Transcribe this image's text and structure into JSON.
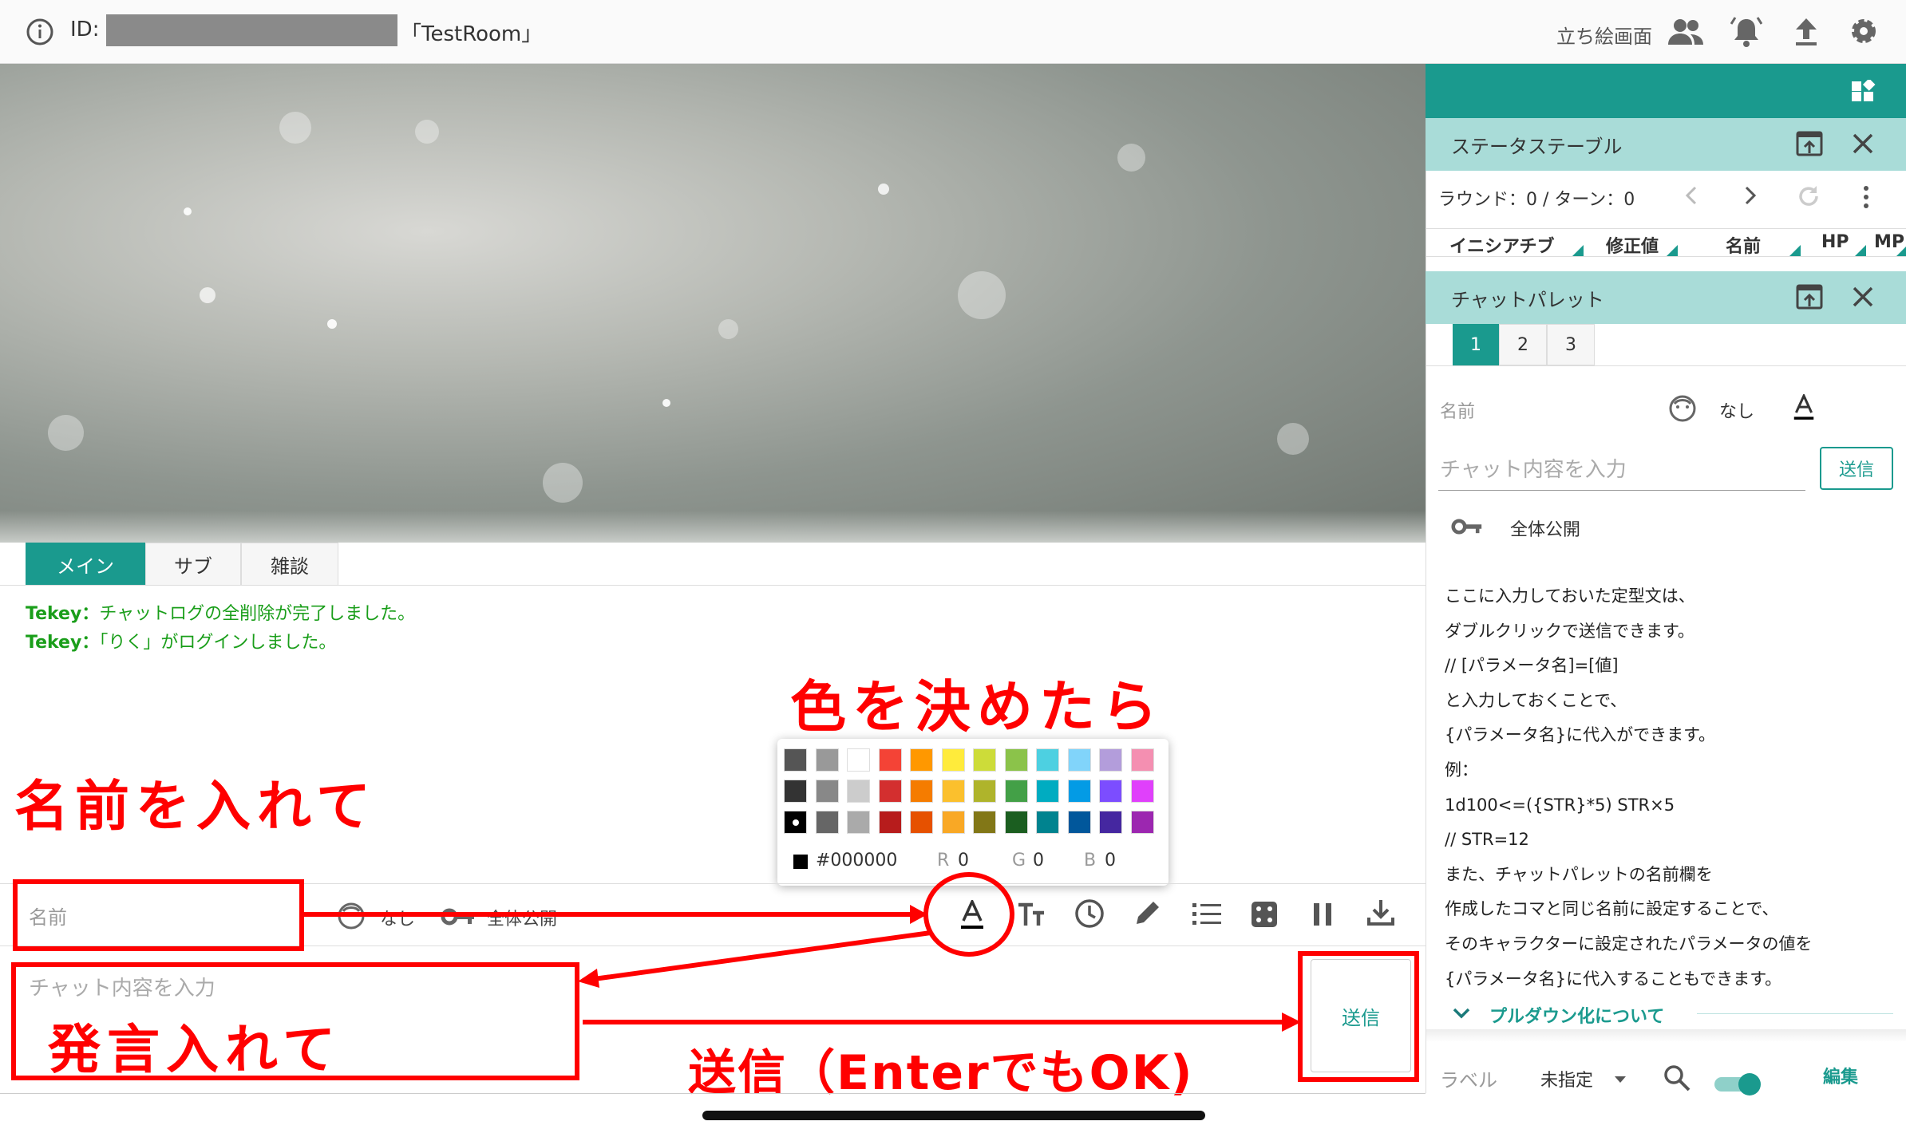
{
  "topbar": {
    "id_label": "ID:",
    "room_name": "「TestRoom」",
    "standing_view": "立ち絵画面"
  },
  "tabs": [
    "メイン",
    "サブ",
    "雑談"
  ],
  "chatlog": [
    {
      "speaker": "Tekey：",
      "text": "チャットログの全削除が完了しました。"
    },
    {
      "speaker": "Tekey：",
      "text": "「りく」がログインしました。"
    }
  ],
  "input": {
    "name_placeholder": "名前",
    "avatar_label": "なし",
    "visibility": "全体公開",
    "chat_placeholder": "チャット内容を入力",
    "send": "送信"
  },
  "colorpicker": {
    "hex": "#000000",
    "r_label": "R",
    "r_value": "0",
    "g_label": "G",
    "g_value": "0",
    "b_label": "B",
    "b_value": "0",
    "rows": [
      [
        "#555555",
        "#999999",
        "#ffffff",
        "#f44336",
        "#ff9800",
        "#ffeb3b",
        "#cddc39",
        "#8bc34a",
        "#4dd0e1",
        "#81d4fa",
        "#b39ddb",
        "#f48fb1"
      ],
      [
        "#333333",
        "#888888",
        "#cccccc",
        "#d32f2f",
        "#f57c00",
        "#fbc02d",
        "#afb42b",
        "#43a047",
        "#00acc1",
        "#039be5",
        "#7c4dff",
        "#e040fb"
      ],
      [
        "#000000",
        "#666666",
        "#aaaaaa",
        "#b71c1c",
        "#e65100",
        "#f9a825",
        "#827717",
        "#1b5e20",
        "#00838f",
        "#01579b",
        "#4527a0",
        "#9c27b0"
      ]
    ]
  },
  "annotations": {
    "decide_color": "色を決めたら",
    "enter_name": "名前を入れて",
    "enter_message": "発言入れて",
    "send_note": "送信（EnterでもOK)"
  },
  "status_table": {
    "title": "ステータステーブル",
    "round_label": "ラウンド：0 / ターン：0",
    "columns": [
      "イニシアチブ",
      "修正値",
      "名前",
      "HP",
      "MP"
    ]
  },
  "chat_palette": {
    "title": "チャットパレット",
    "tabs": [
      "1",
      "2",
      "3"
    ],
    "name_placeholder": "名前",
    "avatar_label": "なし",
    "chat_placeholder": "チャット内容を入力",
    "send": "送信",
    "visibility": "全体公開",
    "lines": [
      "ここに入力しておいた定型文は、",
      "ダブルクリックで送信できます。",
      "// [パラメータ名]=[値]",
      "と入力しておくことで、",
      "{パラメータ名}に代入ができます。",
      "例：",
      "1d100<=({STR}*5) STR×5",
      "// STR=12",
      "また、チャットパレットの名前欄を",
      "作成したコマと同じ名前に設定することで、",
      "そのキャラクターに設定されたパラメータの値を",
      "{パラメータ名}に代入することもできます。"
    ],
    "dropdown_title": "プルダウン化について",
    "label": "ラベル",
    "label_value": "未指定",
    "edit": "編集"
  },
  "colors": {
    "accent": "#1a9a8e",
    "header_bg": "#a9dcd8",
    "log_green": "#1a9e1a",
    "annotation_red": "#ff0000"
  }
}
